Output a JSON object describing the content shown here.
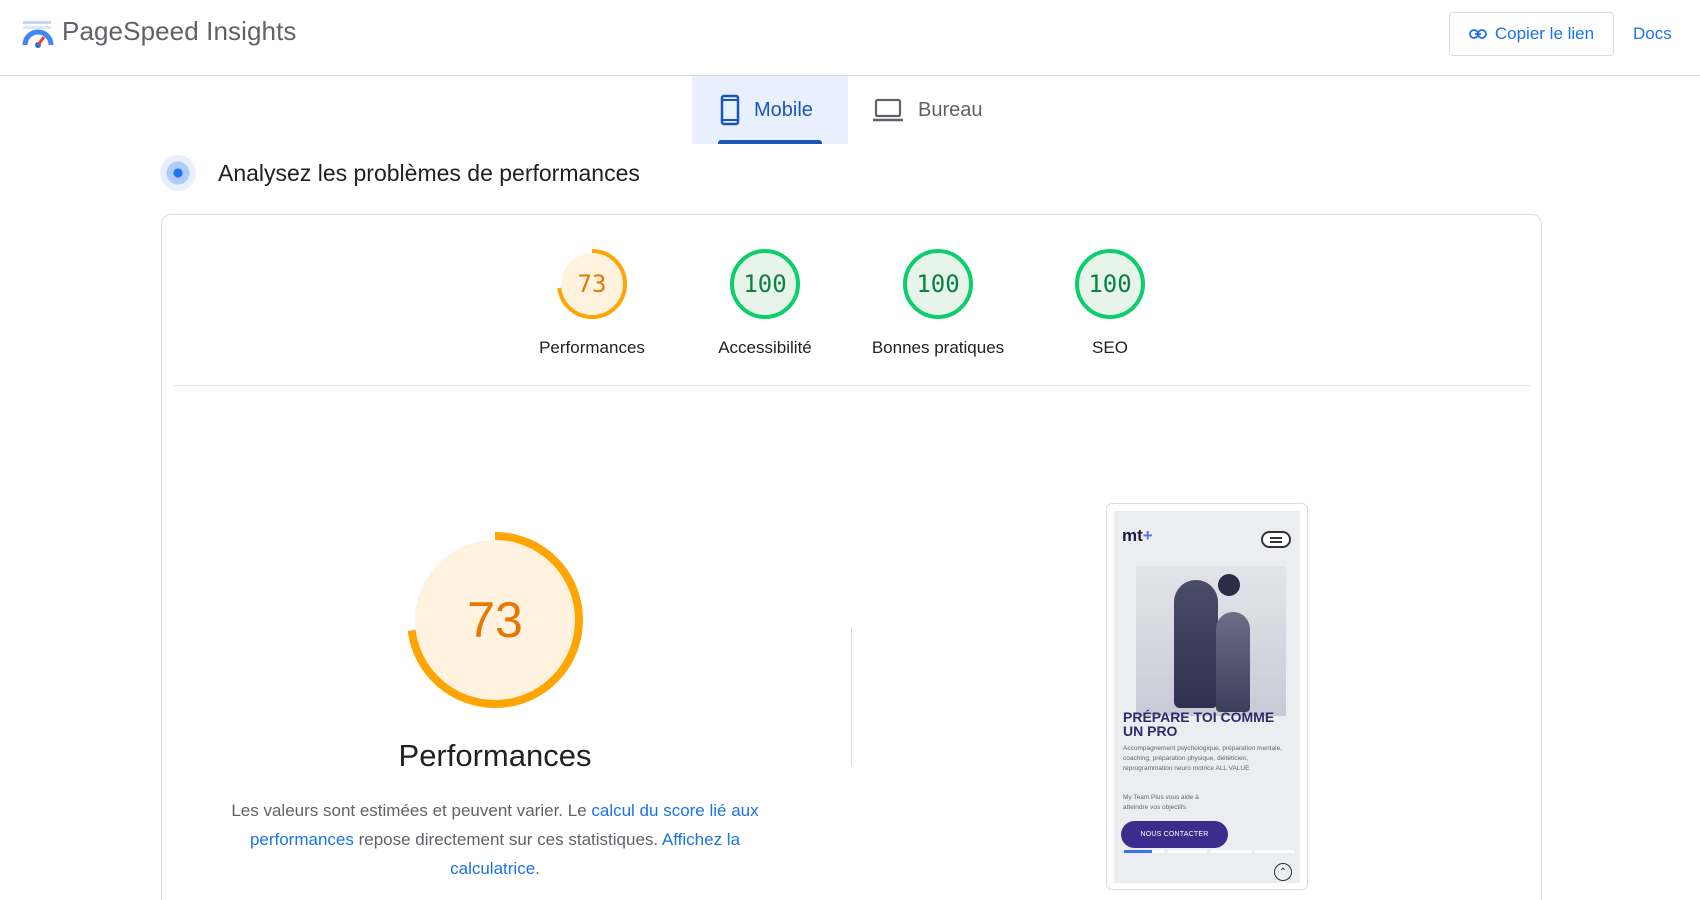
{
  "header": {
    "app_title": "PageSpeed Insights",
    "copy_link_label": "Copier le lien",
    "docs_label": "Docs"
  },
  "tabs": [
    {
      "label": "Mobile",
      "active": true,
      "icon": "smartphone-icon"
    },
    {
      "label": "Bureau",
      "active": false,
      "icon": "laptop-icon"
    }
  ],
  "section": {
    "title": "Analysez les problèmes de performances"
  },
  "scores": [
    {
      "label": "Performances",
      "value": "73",
      "fraction": 0.73,
      "color": "#e67700",
      "ring": "#ffa400",
      "fill": "#fff3e0"
    },
    {
      "label": "Accessibilité",
      "value": "100",
      "fraction": 1.0,
      "color": "#0b8043",
      "ring": "#0cce6b",
      "fill": "#e6f4ea"
    },
    {
      "label": "Bonnes pratiques",
      "value": "100",
      "fraction": 1.0,
      "color": "#0b8043",
      "ring": "#0cce6b",
      "fill": "#e6f4ea"
    },
    {
      "label": "SEO",
      "value": "100",
      "fraction": 1.0,
      "color": "#0b8043",
      "ring": "#0cce6b",
      "fill": "#e6f4ea"
    }
  ],
  "main": {
    "score": "73",
    "title": "Performances",
    "desc_part1": "Les valeurs sont estimées et peuvent varier. Le ",
    "desc_link1": "calcul du score lié aux performances",
    "desc_part2": " repose directement sur ces statistiques. ",
    "desc_link2": "Affichez la calculatrice",
    "desc_part3": "."
  },
  "preview": {
    "logo": "mt",
    "logo_plus": "+",
    "headline": "PRÉPARE TOI COMME UN PRO",
    "text1": "Accompagnement psychologique, préparation mentale, coaching, préparation physique, diététicien, reprogrammation neuro motrice ALL VALUE",
    "text2": "My Team Plus vous aide à atteindre vos objectifs.",
    "cta": "NOUS CONTACTER"
  }
}
